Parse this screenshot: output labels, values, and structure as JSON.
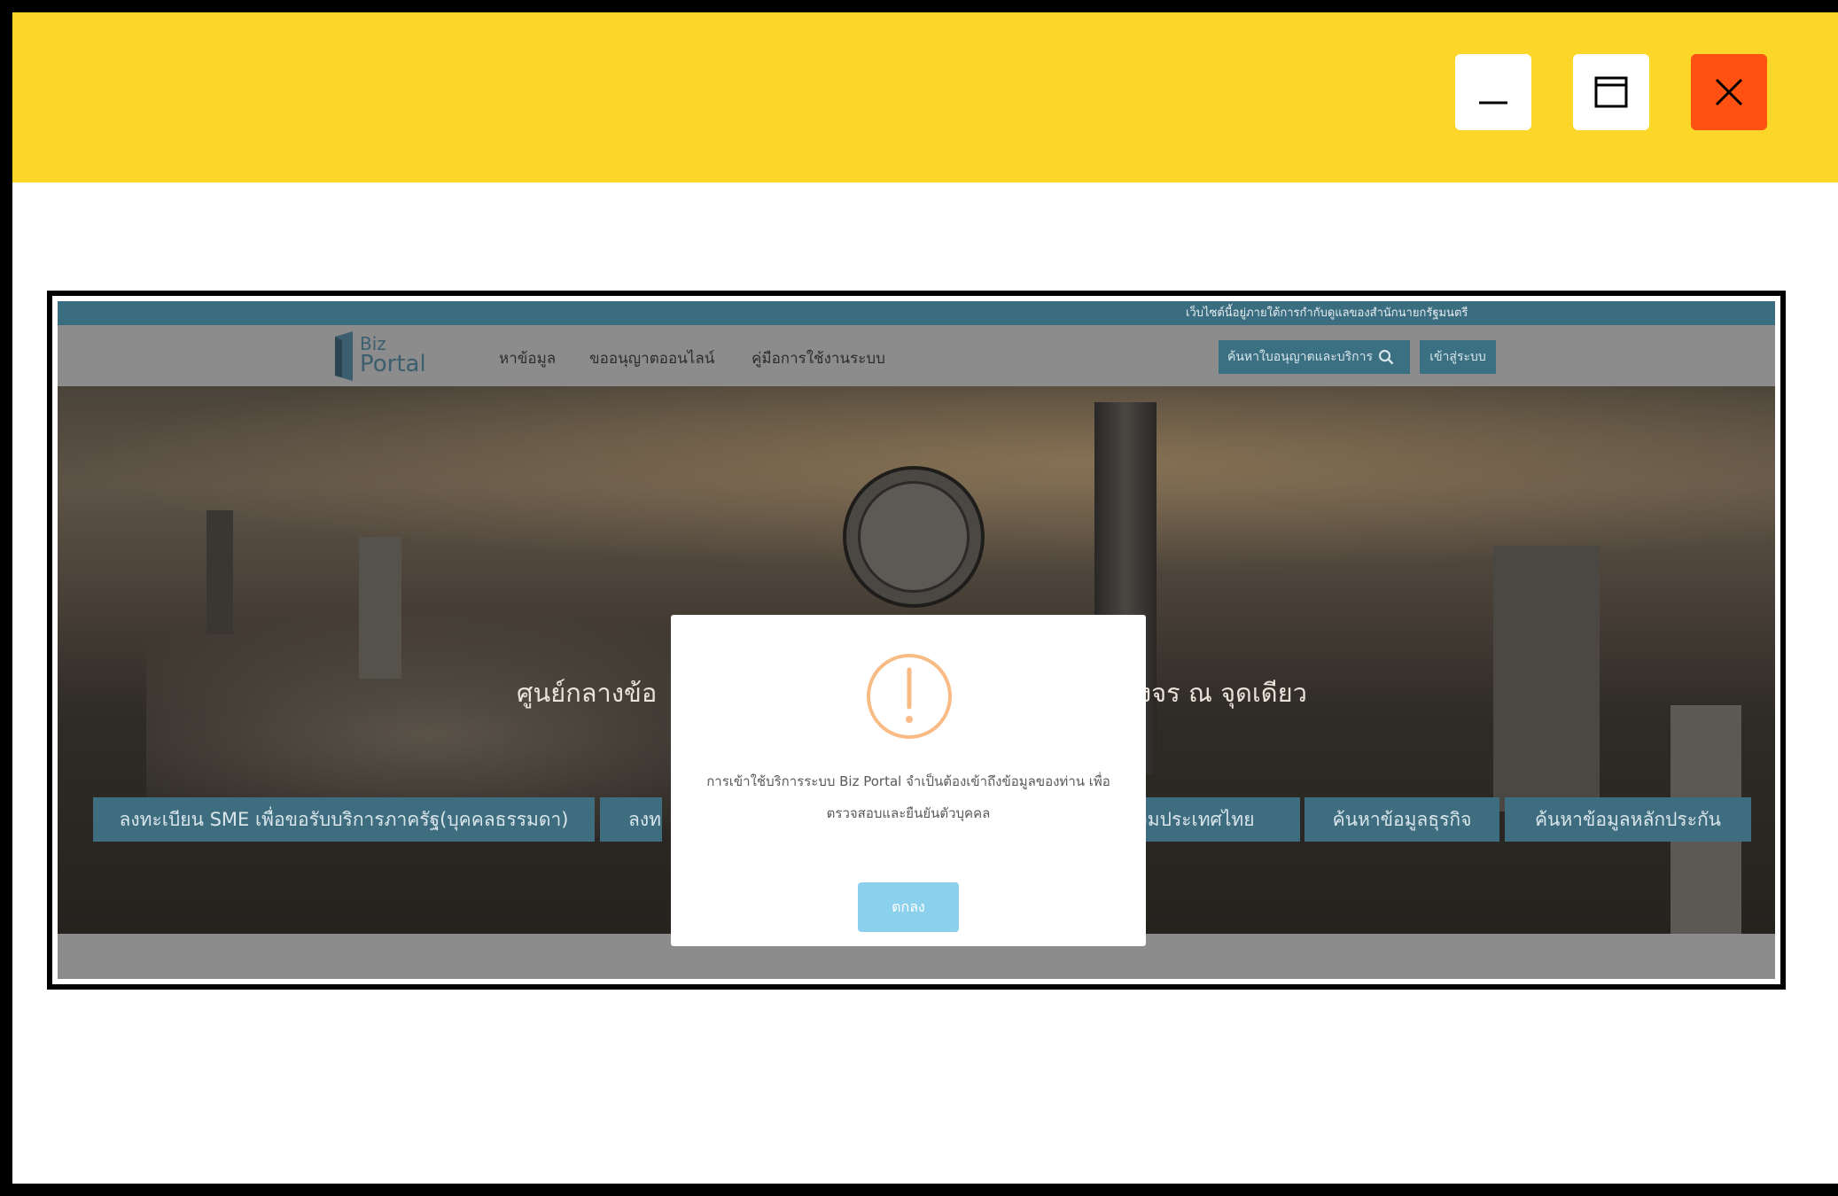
{
  "window": {
    "controls": {
      "minimize_icon": "minimize-icon",
      "maximize_icon": "maximize-icon",
      "close_icon": "close-icon",
      "titlebar_color": "#fcd628",
      "close_color": "#ff5212"
    }
  },
  "site": {
    "gov_notice": "เว็บไซต์นี้อยู่ภายใต้การกำกับดูแลของสำนักนายกรัฐมนตรี",
    "logo": {
      "line1": "Biz",
      "line2": "Portal"
    },
    "nav": {
      "items": [
        "หาข้อมูล",
        "ขออนุญาตออนไลน์",
        "คู่มือการใช้งานระบบ"
      ],
      "search_button": "ค้นหาใบอนุญาตและบริการ",
      "login_button": "เข้าสู่ระบบ"
    },
    "hero": {
      "title_left": "ศูนย์กลางข้อ",
      "title_right": "งจร ณ จุดเดียว",
      "buttons": [
        "ลงทะเบียน SME เพื่อขอรับบริการภาครัฐ(บุคคลธรรมดา)",
        "ลงท",
        "วมประเทศไทย",
        "ค้นหาข้อมูลธุรกิจ",
        "ค้นหาข้อมูลหลักประกัน"
      ]
    }
  },
  "modal": {
    "icon": "exclamation-circle-icon",
    "icon_color": "#f8bb86",
    "message_line1": "การเข้าใช้บริการระบบ Biz Portal จำเป็นต้องเข้าถึงข้อมูลของท่าน เพื่อ",
    "message_line2": "ตรวจสอบและยืนยันตัวบุคคล",
    "ok_label": "ตกลง",
    "ok_color": "#8bd0ec"
  }
}
